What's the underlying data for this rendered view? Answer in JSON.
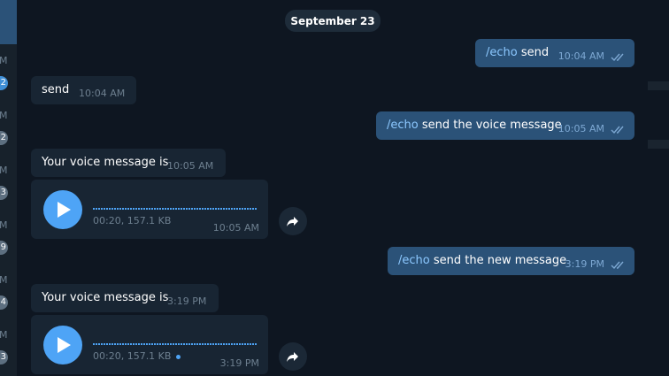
{
  "sidebar": {
    "times": [
      "M",
      "M",
      "M",
      "M",
      "M",
      "M"
    ],
    "badges": [
      {
        "count": "2",
        "style": "blue"
      },
      {
        "count": "2",
        "style": "gray"
      },
      {
        "count": "3",
        "style": "gray"
      },
      {
        "count": "9",
        "style": "gray"
      },
      {
        "count": "4",
        "style": "gray"
      },
      {
        "count": "3",
        "style": "gray"
      }
    ]
  },
  "chat": {
    "date_separator": "September 23",
    "messages": [
      {
        "direction": "out",
        "command": "/echo",
        "text": " send",
        "time": "10:04 AM",
        "status": "double-check-icon"
      },
      {
        "direction": "in",
        "text": "send",
        "time": "10:04 AM"
      },
      {
        "direction": "out",
        "command": "/echo",
        "text": " send the voice message",
        "time": "10:05 AM",
        "status": "double-check-icon"
      },
      {
        "direction": "in",
        "text": "Your voice message is",
        "time": "10:05 AM"
      },
      {
        "direction": "in",
        "type": "voice",
        "duration_size": "00:20, 157.1 KB",
        "time": "10:05 AM",
        "unread": false
      },
      {
        "direction": "out",
        "command": "/echo",
        "text": " send the new message",
        "time": "3:19 PM",
        "status": "double-check-icon"
      },
      {
        "direction": "in",
        "text": "Your voice message is",
        "time": "3:19 PM"
      },
      {
        "direction": "in",
        "type": "voice",
        "duration_size": "00:20, 157.1 KB",
        "time": "3:19 PM",
        "unread": true
      }
    ]
  },
  "colors": {
    "background": "#0e1621",
    "outgoing_bubble": "#2b5278",
    "incoming_bubble": "#182533",
    "accent": "#4ea4f6",
    "command": "#8cc8ff"
  }
}
